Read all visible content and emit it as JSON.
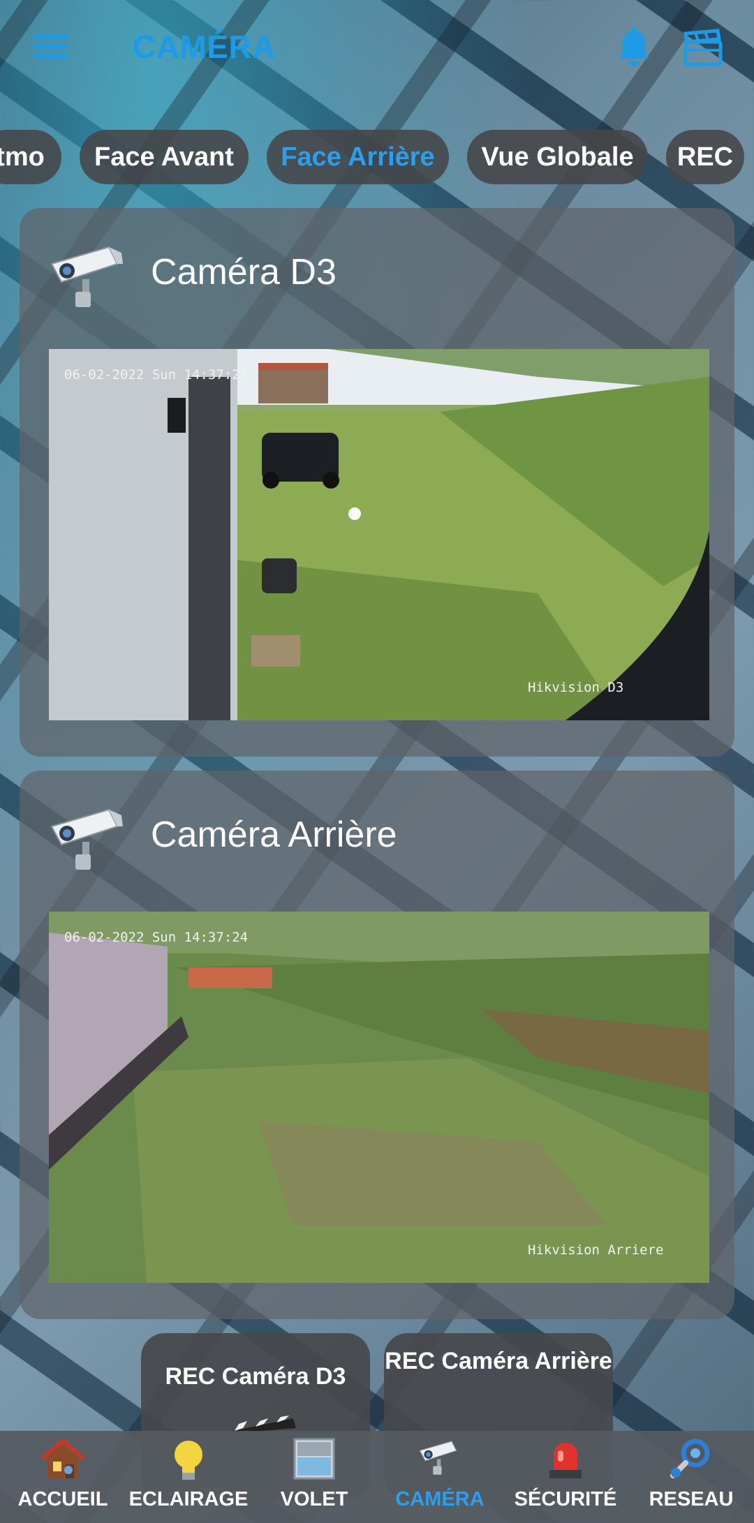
{
  "header": {
    "title": "CAMÉRA",
    "menu_icon": "menu-icon",
    "notifications_icon": "bell-icon",
    "media_icon": "clapperboard-icon",
    "accent_color": "#1e9be6"
  },
  "tabs": [
    {
      "label": "tmo",
      "active": false
    },
    {
      "label": "Face Avant",
      "active": false
    },
    {
      "label": "Face Arrière",
      "active": true
    },
    {
      "label": "Vue Globale",
      "active": false
    },
    {
      "label": "REC",
      "active": false
    }
  ],
  "cameras": [
    {
      "title": "Caméra D3",
      "icon": "cctv-camera-icon",
      "timestamp": "06-02-2022 Sun 14:37:24",
      "overlay_name": "Hikvision D3"
    },
    {
      "title": "Caméra Arrière",
      "icon": "cctv-camera-icon",
      "timestamp": "06-02-2022 Sun 14:37:24",
      "overlay_name": "Hikvision Arriere"
    }
  ],
  "rec_buttons": [
    {
      "label": "REC Caméra D3"
    },
    {
      "label": "REC Caméra Arrière"
    }
  ],
  "bottom_nav": [
    {
      "label": "ACCUEIL",
      "icon": "house-icon",
      "active": false
    },
    {
      "label": "ECLAIRAGE",
      "icon": "lightbulb-icon",
      "active": false
    },
    {
      "label": "VOLET",
      "icon": "shutter-icon",
      "active": false
    },
    {
      "label": "CAMÉRA",
      "icon": "cctv-camera-icon",
      "active": true
    },
    {
      "label": "SÉCURITÉ",
      "icon": "siren-icon",
      "active": false
    },
    {
      "label": "RESEAU",
      "icon": "network-icon",
      "active": false
    }
  ]
}
